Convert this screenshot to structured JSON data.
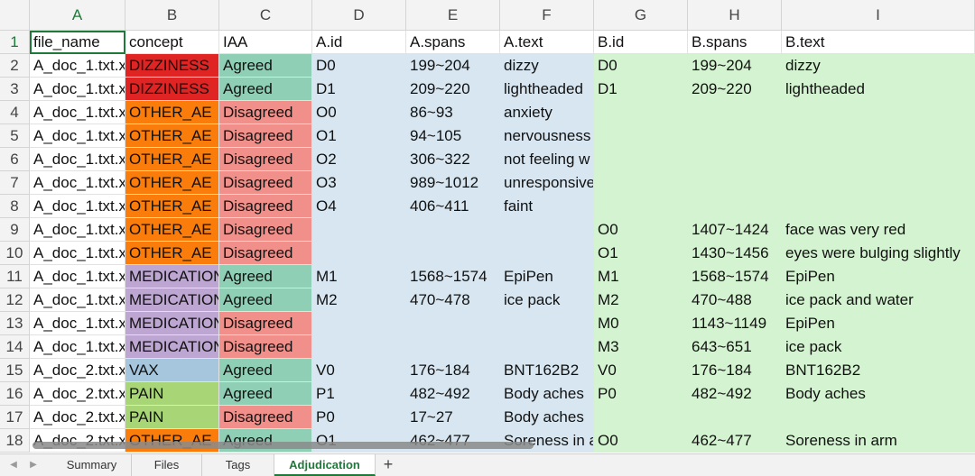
{
  "columns": [
    "A",
    "B",
    "C",
    "D",
    "E",
    "F",
    "G",
    "H",
    "I"
  ],
  "selected_column": "A",
  "header_row": [
    "file_name",
    "concept",
    "IAA",
    "A.id",
    "A.spans",
    "A.text",
    "B.id",
    "B.spans",
    "B.text"
  ],
  "rows": [
    [
      "A_doc_1.txt.x",
      "DIZZINESS",
      "Agreed",
      "D0",
      "199~204",
      "dizzy",
      "D0",
      "199~204",
      "dizzy"
    ],
    [
      "A_doc_1.txt.x",
      "DIZZINESS",
      "Agreed",
      "D1",
      "209~220",
      "lightheaded",
      "D1",
      "209~220",
      "lightheaded"
    ],
    [
      "A_doc_1.txt.x",
      "OTHER_AE",
      "Disagreed",
      "O0",
      "86~93",
      "anxiety",
      "",
      "",
      ""
    ],
    [
      "A_doc_1.txt.x",
      "OTHER_AE",
      "Disagreed",
      "O1",
      "94~105",
      "nervousness",
      "",
      "",
      ""
    ],
    [
      "A_doc_1.txt.x",
      "OTHER_AE",
      "Disagreed",
      "O2",
      "306~322",
      "not feeling w",
      "",
      "",
      ""
    ],
    [
      "A_doc_1.txt.x",
      "OTHER_AE",
      "Disagreed",
      "O3",
      "989~1012",
      "unresponsive",
      "",
      "",
      ""
    ],
    [
      "A_doc_1.txt.x",
      "OTHER_AE",
      "Disagreed",
      "O4",
      "406~411",
      "faint",
      "",
      "",
      ""
    ],
    [
      "A_doc_1.txt.x",
      "OTHER_AE",
      "Disagreed",
      "",
      "",
      "",
      "O0",
      "1407~1424",
      "face was very red"
    ],
    [
      "A_doc_1.txt.x",
      "OTHER_AE",
      "Disagreed",
      "",
      "",
      "",
      "O1",
      "1430~1456",
      "eyes were bulging slightly"
    ],
    [
      "A_doc_1.txt.x",
      "MEDICATION",
      "Agreed",
      "M1",
      "1568~1574",
      "EpiPen",
      "M1",
      "1568~1574",
      "EpiPen"
    ],
    [
      "A_doc_1.txt.x",
      "MEDICATION",
      "Agreed",
      "M2",
      "470~478",
      "ice pack",
      "M2",
      "470~488",
      "ice pack and water"
    ],
    [
      "A_doc_1.txt.x",
      "MEDICATION",
      "Disagreed",
      "",
      "",
      "",
      "M0",
      "1143~1149",
      "EpiPen"
    ],
    [
      "A_doc_1.txt.x",
      "MEDICATION",
      "Disagreed",
      "",
      "",
      "",
      "M3",
      "643~651",
      "ice pack"
    ],
    [
      "A_doc_2.txt.x",
      "VAX",
      "Agreed",
      "V0",
      "176~184",
      "BNT162B2",
      "V0",
      "176~184",
      "BNT162B2"
    ],
    [
      "A_doc_2.txt.x",
      "PAIN",
      "Agreed",
      "P1",
      "482~492",
      "Body aches",
      "P0",
      "482~492",
      "Body aches"
    ],
    [
      "A_doc_2.txt.x",
      "PAIN",
      "Disagreed",
      "P0",
      "17~27",
      "Body aches",
      "",
      "",
      ""
    ],
    [
      "A_doc_2.txt.x",
      "OTHER_AE",
      "Agreed",
      "O1",
      "462~477",
      "Soreness in a",
      "O0",
      "462~477",
      "Soreness in arm"
    ]
  ],
  "tabs": [
    "Summary",
    "Files",
    "Tags",
    "Adjudication"
  ],
  "active_tab": "Adjudication",
  "add_tab_label": "+",
  "colors": {
    "DIZZINESS": "#e02323",
    "OTHER_AE": "#fa7d0c",
    "MEDICATION": "#bda6d1",
    "VAX": "#a6c6de",
    "PAIN": "#a8d676",
    "Agreed": "#8fcfb5",
    "Disagreed": "#f1908a",
    "annotator_a": "#d7e6f0",
    "annotator_b": "#d4f3d0",
    "accent": "#1f7a3a"
  }
}
